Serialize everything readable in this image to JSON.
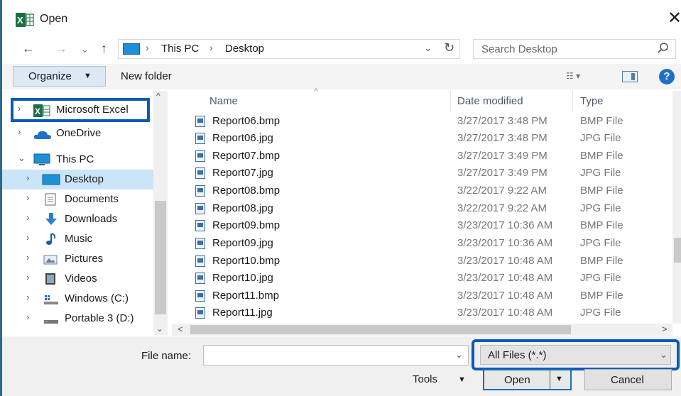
{
  "window": {
    "title": "Open",
    "app_icon": "excel-icon",
    "close_glyph": "✕"
  },
  "address": {
    "back_glyph": "←",
    "forward_glyph": "→",
    "recent_glyph": "⌄",
    "up_glyph": "↑",
    "breadcrumbs": [
      "This PC",
      "Desktop"
    ],
    "separator": "›",
    "dropdown_glyph": "⌄",
    "refresh_glyph": "↻"
  },
  "search": {
    "placeholder": "Search Desktop"
  },
  "toolbar": {
    "organize_label": "Organize",
    "organize_caret": "▼",
    "new_folder_label": "New folder",
    "view_glyph": "☷ ▾",
    "help_label": "?"
  },
  "navigation": {
    "items": [
      {
        "label": "Microsoft Excel",
        "icon": "excel-icon"
      },
      {
        "label": "OneDrive",
        "icon": "cloud-icon"
      },
      {
        "label": "This PC",
        "icon": "computer-icon"
      },
      {
        "label": "Desktop",
        "icon": "desktop-icon"
      },
      {
        "label": "Documents",
        "icon": "documents-icon"
      },
      {
        "label": "Downloads",
        "icon": "download-icon"
      },
      {
        "label": "Music",
        "icon": "music-icon"
      },
      {
        "label": "Pictures",
        "icon": "pictures-icon"
      },
      {
        "label": "Videos",
        "icon": "videos-icon"
      },
      {
        "label": "Windows (C:)",
        "icon": "drive-icon"
      },
      {
        "label": "Portable 3 (D:)",
        "icon": "drive-icon"
      }
    ],
    "expand_glyph": "›",
    "expanded_glyph": "⌄"
  },
  "file_list": {
    "columns": [
      "Name",
      "Date modified",
      "Type"
    ],
    "rows": [
      {
        "name": "Report06.bmp",
        "date": "3/27/2017 3:48 PM",
        "type": "BMP File"
      },
      {
        "name": "Report06.jpg",
        "date": "3/27/2017 3:48 PM",
        "type": "JPG File"
      },
      {
        "name": "Report07.bmp",
        "date": "3/27/2017 3:49 PM",
        "type": "BMP File"
      },
      {
        "name": "Report07.jpg",
        "date": "3/27/2017 3:49 PM",
        "type": "JPG File"
      },
      {
        "name": "Report08.bmp",
        "date": "3/22/2017 9:22 AM",
        "type": "BMP File"
      },
      {
        "name": "Report08.jpg",
        "date": "3/22/2017 9:22 AM",
        "type": "JPG File"
      },
      {
        "name": "Report09.bmp",
        "date": "3/23/2017 10:36 AM",
        "type": "BMP File"
      },
      {
        "name": "Report09.jpg",
        "date": "3/23/2017 10:36 AM",
        "type": "JPG File"
      },
      {
        "name": "Report10.bmp",
        "date": "3/23/2017 10:48 AM",
        "type": "BMP File"
      },
      {
        "name": "Report10.jpg",
        "date": "3/23/2017 10:48 AM",
        "type": "JPG File"
      },
      {
        "name": "Report11.bmp",
        "date": "3/23/2017 10:48 AM",
        "type": "BMP File"
      },
      {
        "name": "Report11.jpg",
        "date": "3/23/2017 10:48 AM",
        "type": "JPG File"
      }
    ],
    "sort_glyph": "^"
  },
  "scroll": {
    "up": "^",
    "down": "⌄",
    "left": "<",
    "right": ">"
  },
  "footer": {
    "file_name_label": "File name:",
    "file_name_value": "",
    "dropdown_glyph": "⌄",
    "filter_value": "All Files (*.*)",
    "tools_label": "Tools",
    "tools_caret": "▼",
    "open_label": "Open",
    "open_caret": "▼",
    "cancel_label": "Cancel"
  },
  "colors": {
    "highlight_box": "#0a5ab8",
    "selected_nav": "#cce4f7",
    "organize_bg": "#dce8f4"
  }
}
